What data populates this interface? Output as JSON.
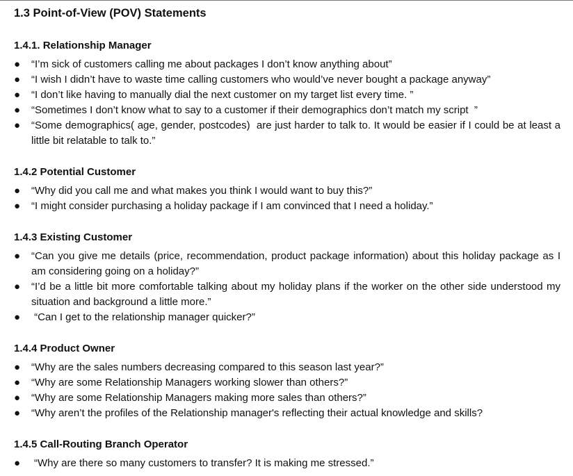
{
  "document": {
    "title": "1.3 Point-of-View (POV) Statements",
    "bullet_glyph": "●",
    "sections": [
      {
        "heading": "1.4.1. Relationship Manager",
        "items": [
          "“I’m sick of customers calling me about packages I don’t know anything about”",
          "“I wish I didn’t have to waste time calling customers who would’ve never bought a package anyway”",
          "“I don’t like having to manually dial the next customer on my target list every time. ”",
          "“Sometimes I don’t know what to say to a customer if their demographics don’t match my script  ”",
          "“Some demographics( age, gender, postcodes)  are just harder to talk to. It would be easier if I could be at least a little bit relatable to talk to.”"
        ]
      },
      {
        "heading": "1.4.2 Potential Customer",
        "items": [
          "“Why did you call me and what makes you think I would want to buy this?”",
          "“I might consider purchasing a holiday package if I am convinced that I need a holiday.”"
        ]
      },
      {
        "heading": "1.4.3 Existing Customer",
        "items": [
          "“Can you give me details (price, recommendation, product package information) about this holiday package as I am considering going on a holiday?”",
          "“I’d be a little bit more comfortable talking about my holiday plans if the worker on the other side understood my situation and background a little more.”",
          " “Can I get to the relationship manager quicker?”"
        ]
      },
      {
        "heading": "1.4.4 Product Owner",
        "items": [
          "“Why are the sales numbers decreasing compared to this season last year?”",
          "“Why are some Relationship Managers working slower than others?”",
          "“Why are some Relationship Managers making more sales than others?”",
          "“Why aren’t the profiles of the Relationship manager's reflecting their actual knowledge and skills?"
        ]
      },
      {
        "heading": "1.4.5 Call-Routing Branch Operator",
        "items": [
          "“Why are there so many customers to transfer? It is making me stressed.”"
        ]
      }
    ]
  }
}
